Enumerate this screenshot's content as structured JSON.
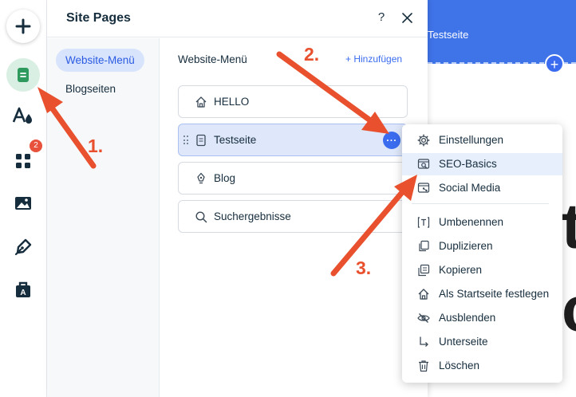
{
  "panel": {
    "title": "Site Pages",
    "help": "?",
    "nav": [
      "Website-Menü",
      "Blogseiten"
    ]
  },
  "content": {
    "section_title": "Website-Menü",
    "add_label": "+ Hinzufügen",
    "pages": [
      {
        "label": "HELLO",
        "icon": "home-icon"
      },
      {
        "label": "Testseite",
        "icon": "page-icon"
      },
      {
        "label": "Blog",
        "icon": "pen-nib-icon"
      },
      {
        "label": "Suchergebnisse",
        "icon": "search-icon"
      }
    ],
    "more_glyph": "···"
  },
  "toolbar": {
    "badge_count": "2",
    "tools": [
      "add-icon",
      "pages-icon",
      "design-icon",
      "apps-icon",
      "media-icon",
      "blog-icon",
      "business-icon"
    ]
  },
  "canvas": {
    "bar_label": "Testseite",
    "plus": "+",
    "glyph_1": "t",
    "glyph_2": "c"
  },
  "menu": {
    "items": [
      {
        "label": "Einstellungen",
        "icon": "gear-icon"
      },
      {
        "label": "SEO-Basics",
        "icon": "seo-search-icon"
      },
      {
        "label": "Social Media",
        "icon": "social-media-icon"
      },
      {
        "label": "Umbenennen",
        "icon": "rename-icon"
      },
      {
        "label": "Duplizieren",
        "icon": "duplicate-icon"
      },
      {
        "label": "Kopieren",
        "icon": "copy-icon"
      },
      {
        "label": "Als Startseite festlegen",
        "icon": "home-icon"
      },
      {
        "label": "Ausblenden",
        "icon": "hide-eye-icon"
      },
      {
        "label": "Unterseite",
        "icon": "subpage-arrow-icon"
      },
      {
        "label": "Löschen",
        "icon": "trash-icon"
      }
    ]
  },
  "annotations": {
    "step1": "1.",
    "step2": "2.",
    "step3": "3.",
    "arrow_color": "#e8502e"
  },
  "colors": {
    "accent": "#3b6cf0",
    "canvas_bar": "#3f73e8",
    "pages_active_bg": "#d9efe3",
    "pages_icon": "#2e8b57"
  }
}
